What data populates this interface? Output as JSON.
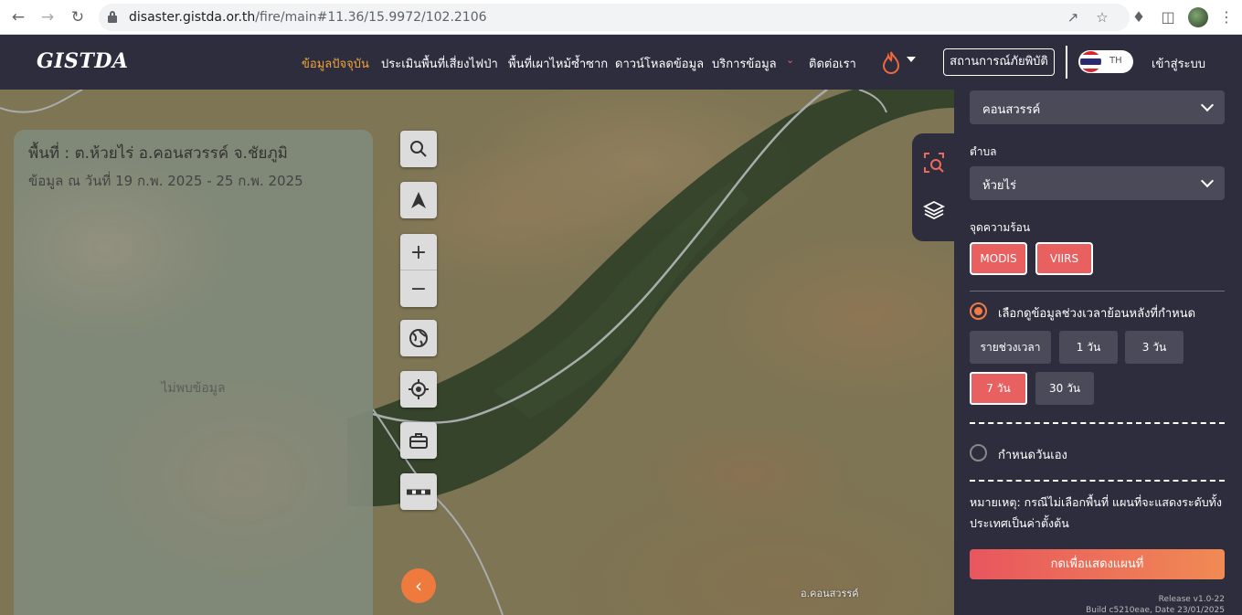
{
  "browser": {
    "url_host": "disaster.gistda.or.th",
    "url_path": "/fire/main#11.36/15.9972/102.2106",
    "back_icon": "arrow-left",
    "forward_icon": "arrow-right",
    "reload_icon": "reload",
    "share_icon": "share",
    "bookmark_icon": "star",
    "extensions_icon": "puzzle",
    "sidepanel_icon": "panel",
    "menu_icon": "kebab"
  },
  "header": {
    "logo": "GISTDA",
    "nav": [
      {
        "label": "ข้อมูลปัจจุบัน",
        "active": true
      },
      {
        "label": "ประเมินพื้นที่เสี่ยงไฟป่า"
      },
      {
        "label": "พื้นที่เผาไหม้ซ้ำซาก"
      },
      {
        "label": "ดาวน์โหลดข้อมูล"
      },
      {
        "label": "บริการข้อมูล"
      },
      {
        "label": "ติดต่อเรา"
      }
    ],
    "disaster_button": "สถานการณ์ภัยพิบัติ",
    "lang": "TH",
    "login": "เข้าสู่ระบบ",
    "accent_color": "#f0a53a"
  },
  "info_panel": {
    "title": "พื้นที่ : ต.ห้วยไร่ อ.คอนสวรรค์ จ.ชัยภูมิ",
    "date_range": "ข้อมูล ณ วันที่ 19 ก.พ. 2025 - 25 ก.พ. 2025",
    "no_data": "ไม่พบข้อมูล"
  },
  "map": {
    "place_label": "อ.คอนสวรรค์",
    "tools": [
      "search-icon",
      "navigation-arrow-icon",
      "zoom-in-icon",
      "zoom-out-icon",
      "globe-icon",
      "locate-icon",
      "toolbox-icon",
      "measure-icon"
    ]
  },
  "filter_panel": {
    "district_value": "คอนสวรรค์",
    "subdistrict_label": "ตำบล",
    "subdistrict_value": "ห้วยไร่",
    "hotspot_label": "จุดความร้อน",
    "hotspot_buttons": [
      "MODIS",
      "VIIRS"
    ],
    "option_period": "เลือกดูข้อมูลช่วงเวลาย้อนหลังที่กำหนด",
    "ranges": [
      "รายช่วงเวลา",
      "1 วัน",
      "3 วัน",
      "7 วัน",
      "30 วัน"
    ],
    "active_range": "7 วัน",
    "option_custom": "กำหนดวันเอง",
    "note": "หมายเหตุ: กรณีไม่เลือกพื้นที่ แผนที่จะแสดงระดับทั้งประเทศเป็นค่าตั้งต้น",
    "show_map_button": "กดเพื่อแสดงแผนที่",
    "release": "Release v1.0-22",
    "build": "Build c5210eae, Date 23/01/2025"
  }
}
